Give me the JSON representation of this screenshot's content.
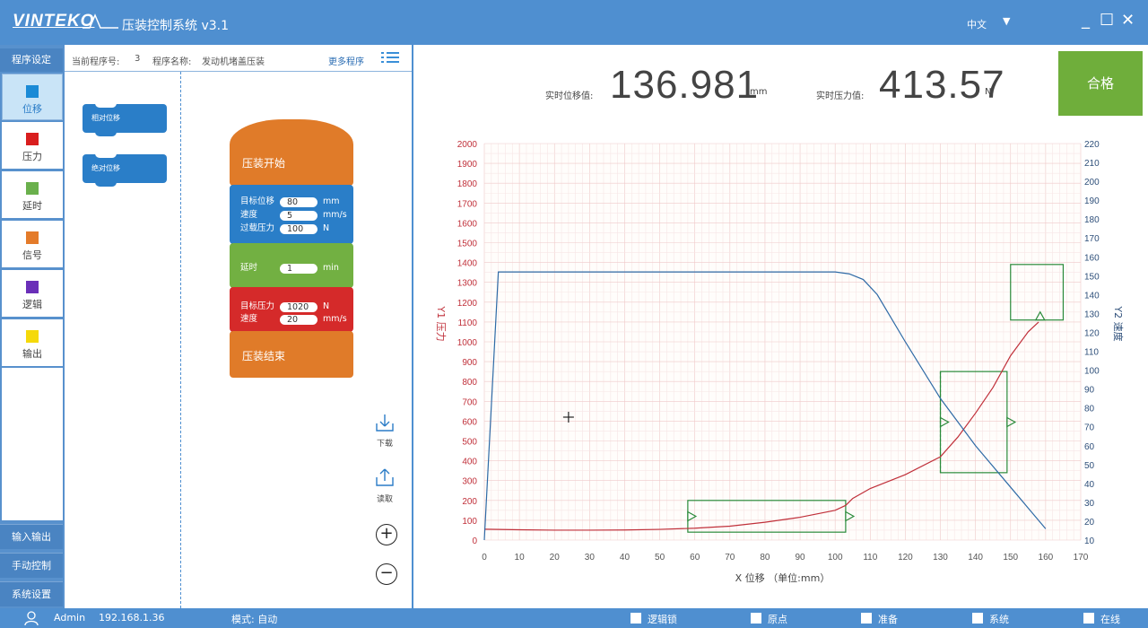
{
  "titlebar": {
    "brand": "VINTEKO",
    "title": "压装控制系统 v3.1",
    "language": "中文",
    "caret": "▼",
    "minimize": "_",
    "maximize": "☐",
    "close": "✕"
  },
  "nav": {
    "header": "程序设定",
    "items": [
      {
        "label": "位移",
        "color": "#1a8ad6"
      },
      {
        "label": "压力",
        "color": "#d91e1e"
      },
      {
        "label": "延时",
        "color": "#6ab04c"
      },
      {
        "label": "信号",
        "color": "#e47b2a"
      },
      {
        "label": "逻辑",
        "color": "#6a2fb8"
      },
      {
        "label": "输出",
        "color": "#f5d90a"
      }
    ],
    "bottom": [
      "输入输出",
      "手动控制",
      "系统设置"
    ]
  },
  "program": {
    "number_label": "当前程序号:",
    "number": "3",
    "name_label": "程序名称:",
    "name": "发动机堵盖压装",
    "more": "更多程序"
  },
  "palette": {
    "relative": "相对位移",
    "absolute": "绝对位移"
  },
  "blocks": {
    "start": "压装开始",
    "target_position_label": "目标位移",
    "target_position": "80",
    "target_position_unit": "mm",
    "speed_label": "速度",
    "speed": "5",
    "speed_unit": "mm/s",
    "overload_label": "过载压力",
    "overload": "100",
    "overload_unit": "N",
    "delay_label": "延时",
    "delay": "1",
    "delay_unit": "min",
    "target_force_label": "目标压力",
    "target_force": "1020",
    "target_force_unit": "N",
    "force_speed_label": "速度",
    "force_speed": "20",
    "force_speed_unit": "mm/s",
    "end": "压装结束"
  },
  "tools": {
    "download": "下载",
    "read": "读取",
    "zoom_in": "+",
    "zoom_out": "−"
  },
  "readout": {
    "position_label": "实时位移值:",
    "position_value": "136.981",
    "position_unit": "mm",
    "force_label": "实时压力值:",
    "force_value": "413.57",
    "force_unit": "N",
    "result": "合格"
  },
  "chart_data": {
    "type": "line",
    "xlabel": "X 位移 （单位:mm）",
    "y1label": "Y1 压力",
    "y2label": "Y2 速度",
    "xlim": [
      0,
      170
    ],
    "ylim": [
      0,
      2000
    ],
    "y2lim": [
      10,
      220
    ],
    "grid": true,
    "x_ticks": [
      0,
      10,
      20,
      30,
      40,
      50,
      60,
      70,
      80,
      90,
      100,
      110,
      120,
      130,
      140,
      150,
      160,
      170
    ],
    "y1_ticks": [
      0,
      100,
      200,
      300,
      400,
      500,
      600,
      700,
      800,
      900,
      1000,
      1100,
      1200,
      1300,
      1400,
      1500,
      1600,
      1700,
      1800,
      1900,
      2000
    ],
    "y2_ticks": [
      10,
      20,
      30,
      40,
      50,
      60,
      70,
      80,
      90,
      100,
      110,
      120,
      130,
      140,
      150,
      160,
      170,
      180,
      190,
      200,
      210,
      220
    ],
    "series": [
      {
        "axis": "y1",
        "color": "#c0303a",
        "x": [
          0,
          10,
          20,
          30,
          40,
          50,
          60,
          70,
          80,
          90,
          100,
          103,
          105,
          110,
          120,
          130,
          135,
          140,
          145,
          150,
          155,
          158
        ],
        "values": [
          55,
          52,
          50,
          50,
          51,
          54,
          60,
          70,
          90,
          115,
          150,
          175,
          210,
          260,
          330,
          420,
          520,
          640,
          770,
          930,
          1050,
          1100
        ]
      },
      {
        "axis": "y2",
        "color": "#2e6aa6",
        "x": [
          0,
          4,
          10,
          30,
          60,
          90,
          100,
          104,
          108,
          112,
          120,
          130,
          140,
          150,
          155,
          160
        ],
        "values": [
          10,
          152,
          152,
          152,
          152,
          152,
          152,
          151,
          148,
          140,
          115,
          85,
          60,
          38,
          27,
          16
        ]
      }
    ],
    "windows": [
      {
        "x": [
          58,
          103
        ],
        "y": [
          40,
          200
        ]
      },
      {
        "x": [
          130,
          149
        ],
        "y": [
          340,
          850
        ]
      },
      {
        "x": [
          150,
          165
        ],
        "y": [
          1110,
          1390
        ]
      }
    ],
    "window_color": "#2a8a3a",
    "cursor": {
      "x": 24,
      "y": 620
    }
  },
  "status": {
    "user": "Admin",
    "ip": "192.168.1.36",
    "mode": "模式: 自动",
    "flags": [
      "逻辑锁",
      "原点",
      "准备",
      "系统",
      "在线"
    ]
  }
}
